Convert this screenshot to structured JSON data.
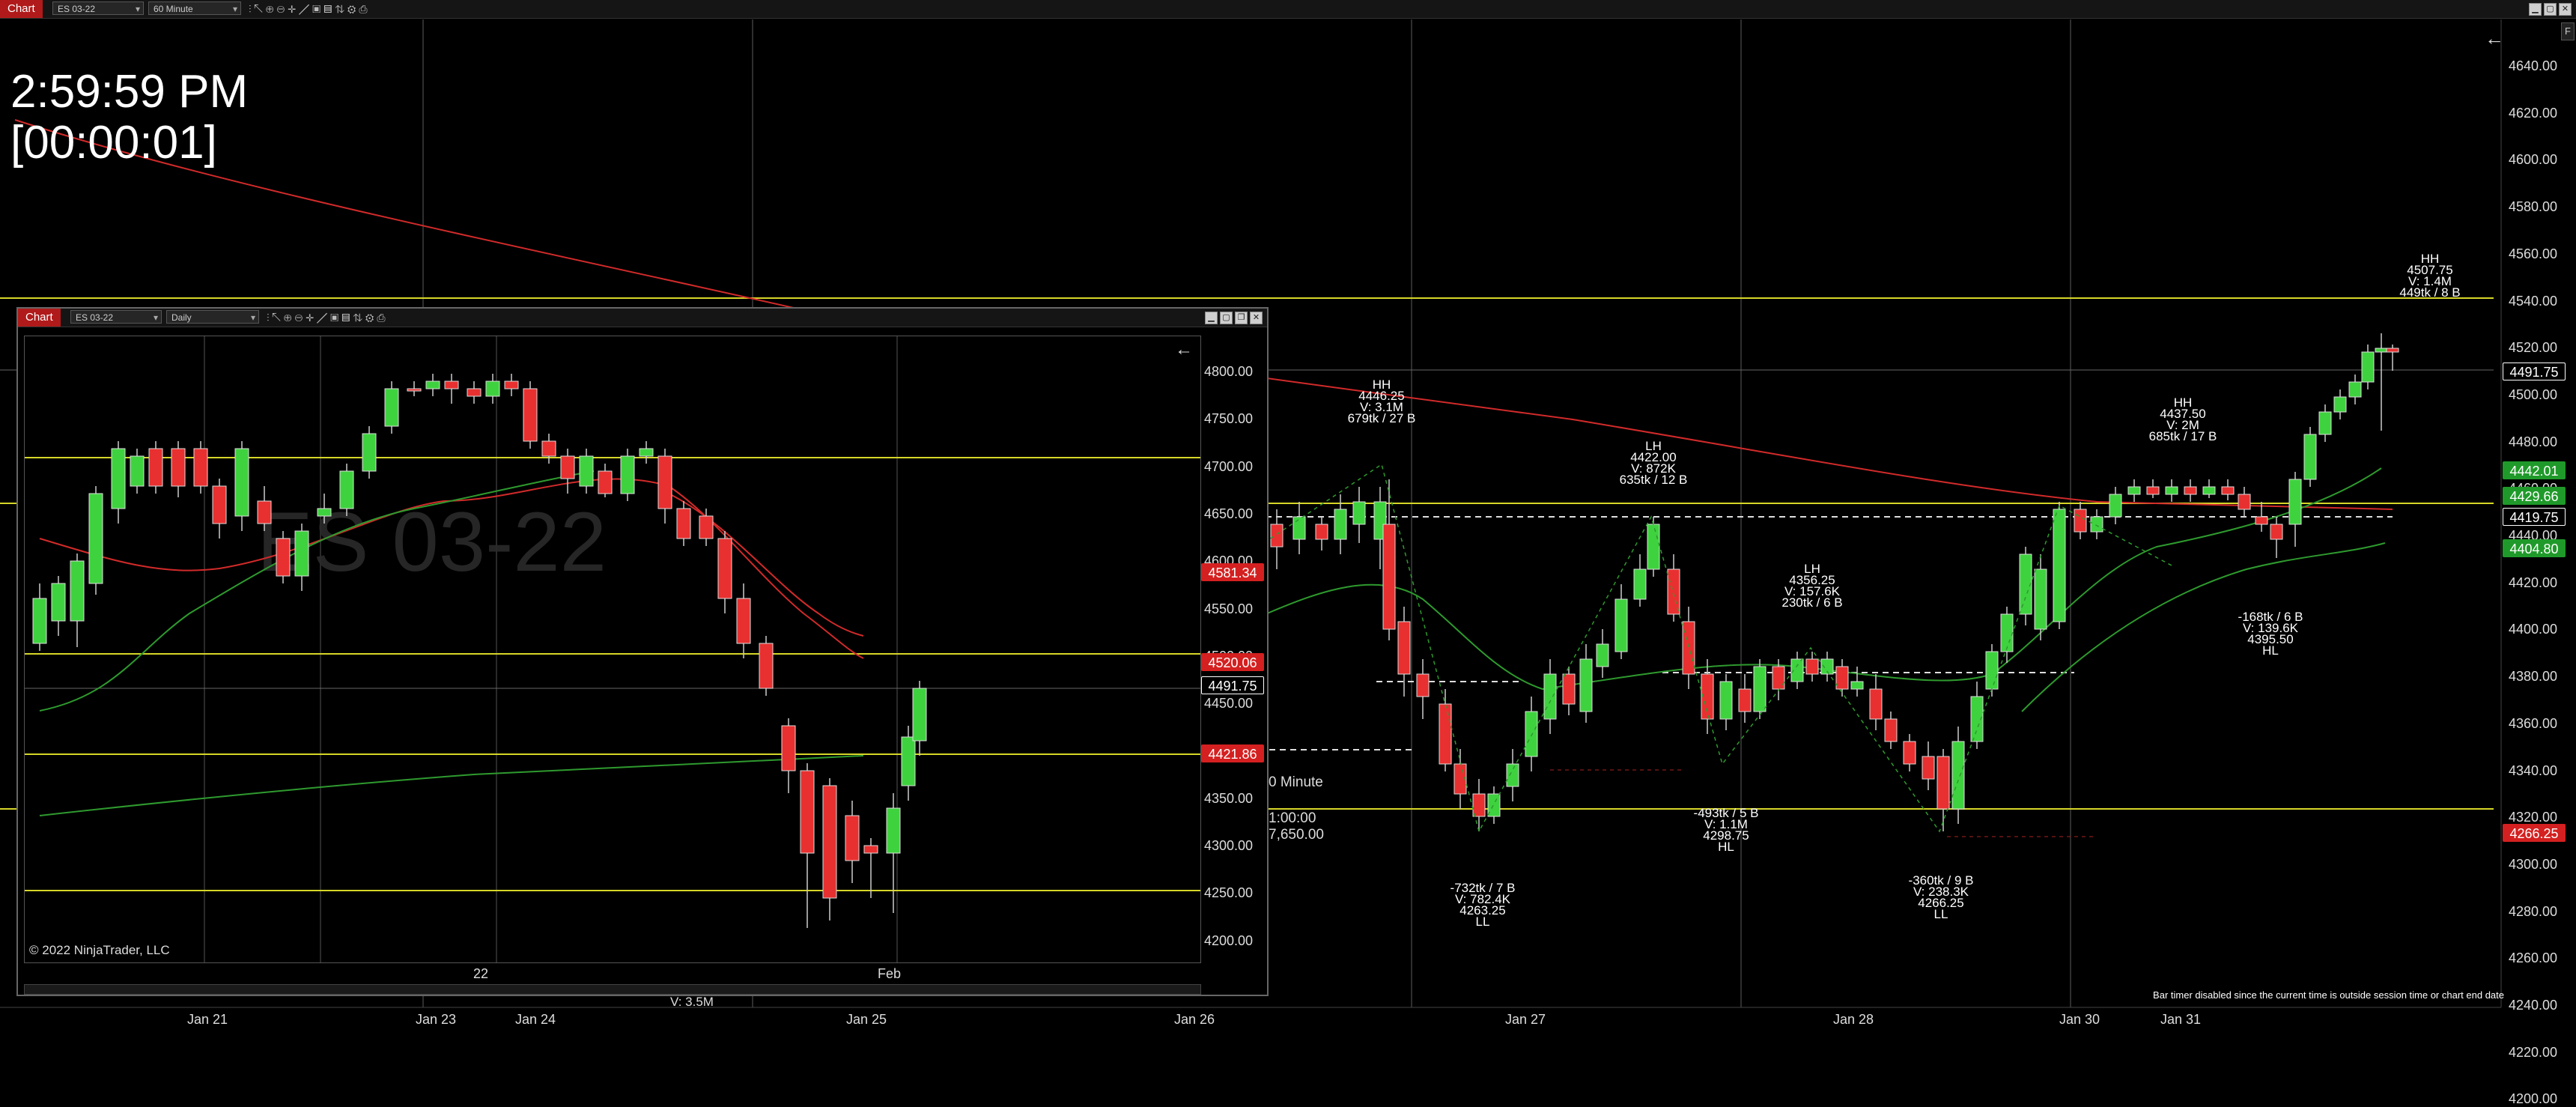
{
  "main": {
    "tab": "Chart",
    "instrument": "ES 03-22",
    "interval": "60 Minute",
    "timer_time": "2:59:59 PM",
    "timer_remaining": "[00:00:01]",
    "footer_note": "Bar timer disabled since the current time is outside session time or chart end date",
    "y_axis": [
      "4640.00",
      "4620.00",
      "4600.00",
      "4580.00",
      "4560.00",
      "4540.00",
      "4520.00",
      "4500.00",
      "4480.00",
      "4460.00",
      "4440.00",
      "4420.00",
      "4400.00",
      "4380.00",
      "4360.00",
      "4340.00",
      "4320.00",
      "4300.00",
      "4280.00",
      "4260.00",
      "4240.00",
      "4220.00",
      "4200.00"
    ],
    "x_axis": [
      "Jan 21",
      "Jan 23",
      "Jan 24",
      "Jan 25",
      "Jan 26",
      "Jan 27",
      "Jan 28",
      "Jan 30",
      "Jan 31"
    ],
    "price_tags": [
      {
        "label": "4491.75",
        "color": "#000000",
        "text": "#ffffff",
        "border": "#ffffff"
      },
      {
        "label": "4442.01",
        "color": "#1f9a2a",
        "text": "#ffffff",
        "border": "#1f9a2a"
      },
      {
        "label": "4429.66",
        "color": "#1f9a2a",
        "text": "#ffffff",
        "border": "#1f9a2a"
      },
      {
        "label": "4419.75",
        "color": "#000000",
        "text": "#ffffff",
        "border": "#ffffff"
      },
      {
        "label": "4404.80",
        "color": "#1f9a2a",
        "text": "#ffffff",
        "border": "#1f9a2a"
      },
      {
        "label": "4266.25",
        "color": "#d42020",
        "text": "#ffffff",
        "border": "#d42020"
      }
    ],
    "swing_labels": [
      {
        "lines": [
          "HH",
          "4446.25",
          "V: 3.1M",
          "679tk / 27 B"
        ]
      },
      {
        "lines": [
          "LH",
          "4422.00",
          "V: 872K",
          "635tk / 12 B"
        ]
      },
      {
        "lines": [
          "LH",
          "4356.25",
          "V: 157.6K",
          "230tk / 6 B"
        ]
      },
      {
        "lines": [
          "HH",
          "4437.50",
          "V: 2M",
          "685tk / 17 B"
        ]
      },
      {
        "lines": [
          "HH",
          "4507.75",
          "V: 1.4M",
          "449tk / 8 B"
        ]
      },
      {
        "lines": [
          "-168tk / 6 B",
          "V: 139.6K",
          "4395.50",
          "HL"
        ]
      },
      {
        "lines": [
          "-493tk / 5 B",
          "V: 1.1M",
          "4298.75",
          "HL"
        ]
      },
      {
        "lines": [
          "-732tk / 7 B",
          "V: 782.4K",
          "4263.25",
          "LL"
        ]
      },
      {
        "lines": [
          "-360tk / 9 B",
          "V: 238.3K",
          "4266.25",
          "LL"
        ]
      }
    ],
    "partial_fragments": [
      "0 Minute",
      "1:00:00",
      "7,650.00",
      "V: 3.5M"
    ]
  },
  "inner": {
    "tab": "Chart",
    "instrument": "ES 03-22",
    "interval": "Daily",
    "watermark": "ES 03-22",
    "copyright": "© 2022 NinjaTrader, LLC",
    "y_axis": [
      "4800.00",
      "4750.00",
      "4700.00",
      "4650.00",
      "4600.00",
      "4550.00",
      "4500.00",
      "4450.00",
      "4400.00",
      "4350.00",
      "4300.00",
      "4250.00",
      "4200.00"
    ],
    "x_axis": [
      "22",
      "Feb"
    ],
    "price_tags": [
      {
        "label": "4581.34",
        "color": "#d42020",
        "text": "#ffffff",
        "border": "#d42020"
      },
      {
        "label": "4520.06",
        "color": "#d42020",
        "text": "#ffffff",
        "border": "#d42020"
      },
      {
        "label": "4491.75",
        "color": "#000000",
        "text": "#ffffff",
        "border": "#ffffff"
      },
      {
        "label": "4421.86",
        "color": "#d42020",
        "text": "#ffffff",
        "border": "#d42020"
      }
    ]
  }
}
